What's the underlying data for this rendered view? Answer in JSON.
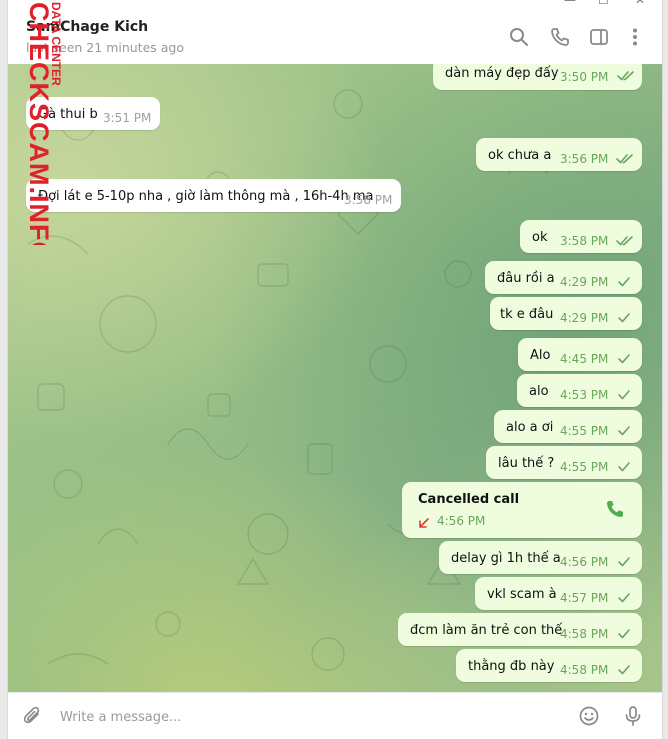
{
  "header": {
    "name": "SamChage Kich",
    "status": "last seen 21 minutes ago"
  },
  "watermark": {
    "main": "CHECKSCAM.INFO",
    "small": "DATA CENTER"
  },
  "messages": [
    {
      "dir": "out",
      "text": "dàn máy đẹp đấy",
      "time": "3:50 PM",
      "status": "read"
    },
    {
      "dir": "in",
      "text": "Gà thui b",
      "time": "3:51 PM"
    },
    {
      "dir": "out",
      "text": "ok chưa a",
      "time": "3:56 PM",
      "status": "read"
    },
    {
      "dir": "in",
      "text": "Đợi lát e 5-10p nha , giờ làm thông mà , 16h-4h ma",
      "time": "3:58 PM"
    },
    {
      "dir": "out",
      "text": "ok",
      "time": "3:58 PM",
      "status": "read"
    },
    {
      "dir": "out",
      "text": "đâu rồi a",
      "time": "4:29 PM",
      "status": "sent"
    },
    {
      "dir": "out",
      "text": "tk e đâu",
      "time": "4:29 PM",
      "status": "sent"
    },
    {
      "dir": "out",
      "text": "Alo",
      "time": "4:45 PM",
      "status": "sent"
    },
    {
      "dir": "out",
      "text": "alo",
      "time": "4:53 PM",
      "status": "sent"
    },
    {
      "dir": "out",
      "text": "alo a ơi",
      "time": "4:55 PM",
      "status": "sent"
    },
    {
      "dir": "out",
      "text": "lâu thế ?",
      "time": "4:55 PM",
      "status": "sent"
    },
    {
      "dir": "out",
      "text": "delay gì 1h thế a",
      "time": "4:56 PM",
      "status": "sent"
    },
    {
      "dir": "out",
      "text": "vkl scam à",
      "time": "4:57 PM",
      "status": "sent"
    },
    {
      "dir": "out",
      "text": "đcm làm ăn trẻ con thế",
      "time": "4:58 PM",
      "status": "sent"
    },
    {
      "dir": "out",
      "text": "thằng đb này",
      "time": "4:58 PM",
      "status": "sent"
    }
  ],
  "call": {
    "title": "Cancelled call",
    "time": "4:56 PM"
  },
  "composer": {
    "placeholder": "Write a message..."
  },
  "colors": {
    "outgoing_bubble": "#effdde",
    "check": "#6aa55c",
    "missed_call_arrow": "#e53935"
  },
  "icons": [
    "search-icon",
    "phone-icon",
    "sidebar-toggle-icon",
    "more-icon",
    "attach-icon",
    "emoji-icon",
    "microphone-icon",
    "call-icon",
    "missed-call-arrow-icon"
  ]
}
